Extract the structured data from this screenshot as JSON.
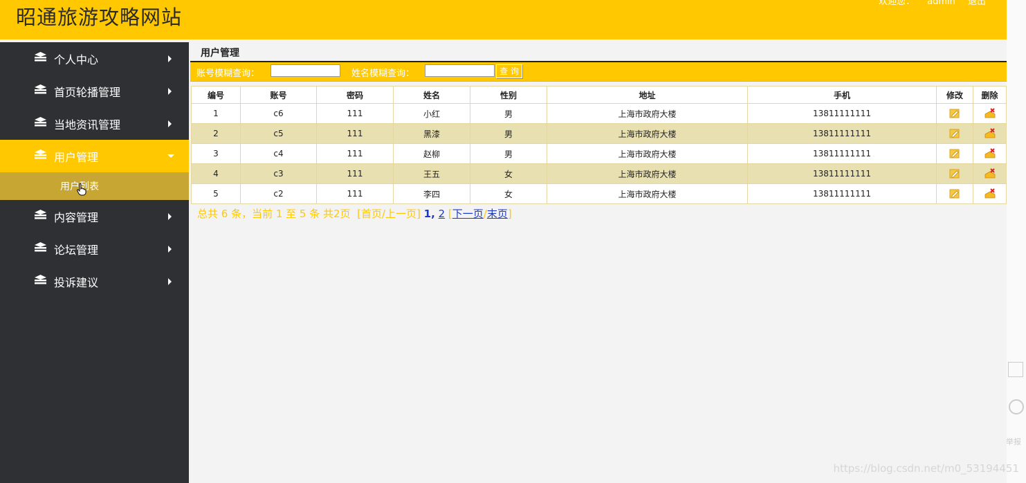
{
  "header": {
    "title": "昭通旅游攻略网站",
    "welcome": "欢迎您：",
    "username": "admin",
    "logout": "退出"
  },
  "sidebar": {
    "items": [
      {
        "label": "个人中心"
      },
      {
        "label": "首页轮播管理"
      },
      {
        "label": "当地资讯管理"
      },
      {
        "label": "用户管理"
      },
      {
        "label": "内容管理"
      },
      {
        "label": "论坛管理"
      },
      {
        "label": "投诉建议"
      }
    ],
    "submenu": {
      "label": "用户列表"
    }
  },
  "main": {
    "heading": "用户管理",
    "search": {
      "account_label": "账号模糊查询：",
      "name_label": "姓名模糊查询：",
      "account_value": "",
      "name_value": "",
      "button": "查 询"
    },
    "table": {
      "headers": [
        "编号",
        "账号",
        "密码",
        "姓名",
        "性别",
        "地址",
        "手机",
        "修改",
        "删除"
      ],
      "rows": [
        [
          "1",
          "c6",
          "111",
          "小红",
          "男",
          "上海市政府大楼",
          "13811111111"
        ],
        [
          "2",
          "c5",
          "111",
          "黑漆",
          "男",
          "上海市政府大楼",
          "13811111111"
        ],
        [
          "3",
          "c4",
          "111",
          "赵柳",
          "男",
          "上海市政府大楼",
          "13811111111"
        ],
        [
          "4",
          "c3",
          "111",
          "王五",
          "女",
          "上海市政府大楼",
          "13811111111"
        ],
        [
          "5",
          "c2",
          "111",
          "李四",
          "女",
          "上海市政府大楼",
          "13811111111"
        ]
      ]
    },
    "pager": {
      "summary": "总共 6 条，当前 1 至 5 条 共2页",
      "first_prev": "[首页/上一页]",
      "page1": "1",
      "sep": ",",
      "page2": "2",
      "next": "下一页",
      "last": "末页"
    }
  },
  "watermark": "https://blog.csdn.net/m0_53194451",
  "right_rail": {
    "text": "举报"
  },
  "colors": {
    "accent": "#ffc800",
    "sidebar": "#2f3033",
    "submenu": "#c8a634",
    "row_alt": "#e8e0b0"
  }
}
